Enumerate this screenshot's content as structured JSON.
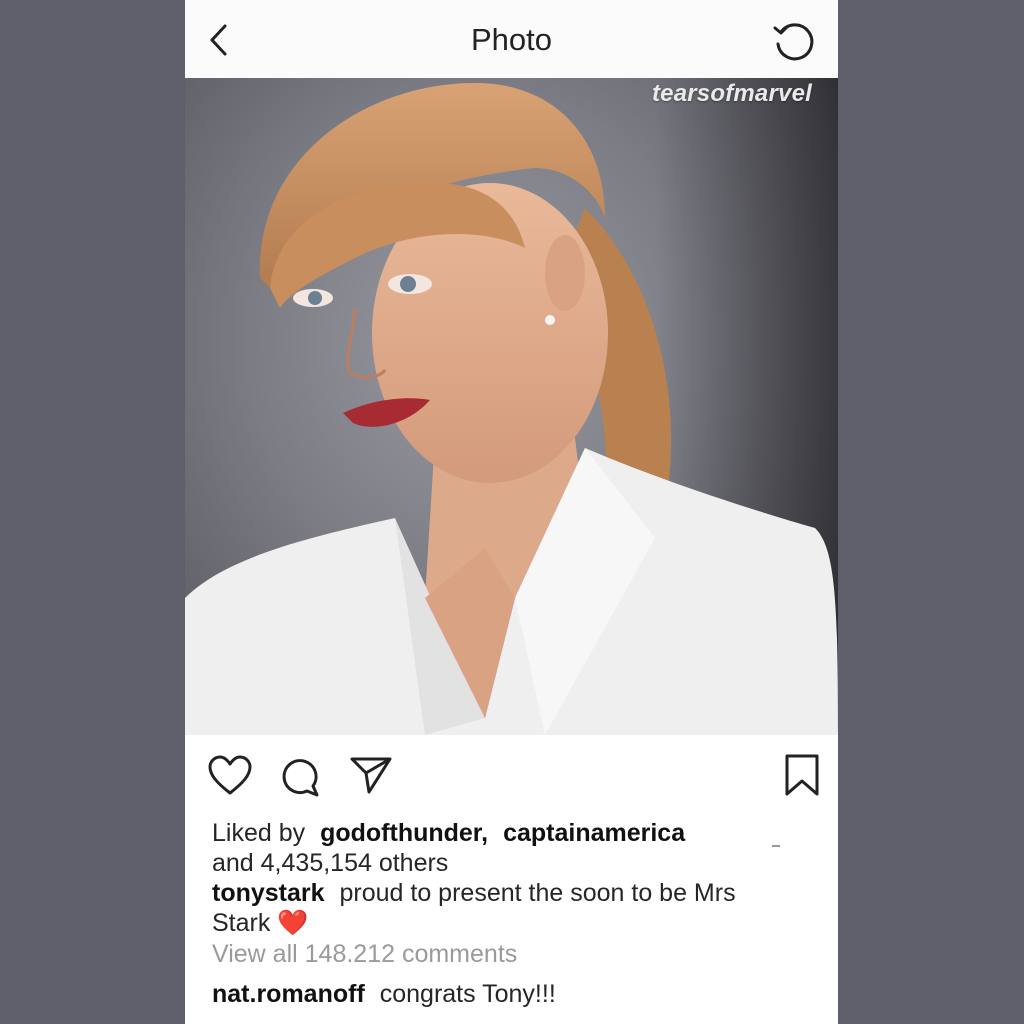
{
  "header": {
    "title": "Photo",
    "back_icon": "chevron-left-icon",
    "refresh_icon": "refresh-icon"
  },
  "photo": {
    "watermark": "tearsofmarvel"
  },
  "actions": {
    "like_icon": "heart-icon",
    "comment_icon": "comment-icon",
    "share_icon": "paper-plane-icon",
    "save_icon": "bookmark-icon"
  },
  "likes": {
    "prefix": "Liked by",
    "user1": "godofthunder,",
    "user2": "captainamerica",
    "rest": "and 4,435,154 others"
  },
  "caption": {
    "username": "tonystark",
    "text": "proud to present the soon to be Mrs Stark",
    "emoji": "❤️"
  },
  "view_all_comments": "View all 148.212 comments",
  "comment": {
    "username": "nat.romanoff",
    "text": "congrats Tony!!!"
  },
  "colors": {
    "background": "#5f5e6b",
    "card": "#ffffff",
    "muted_text": "#9a9a9a",
    "heart_emoji": "#e0243a"
  }
}
